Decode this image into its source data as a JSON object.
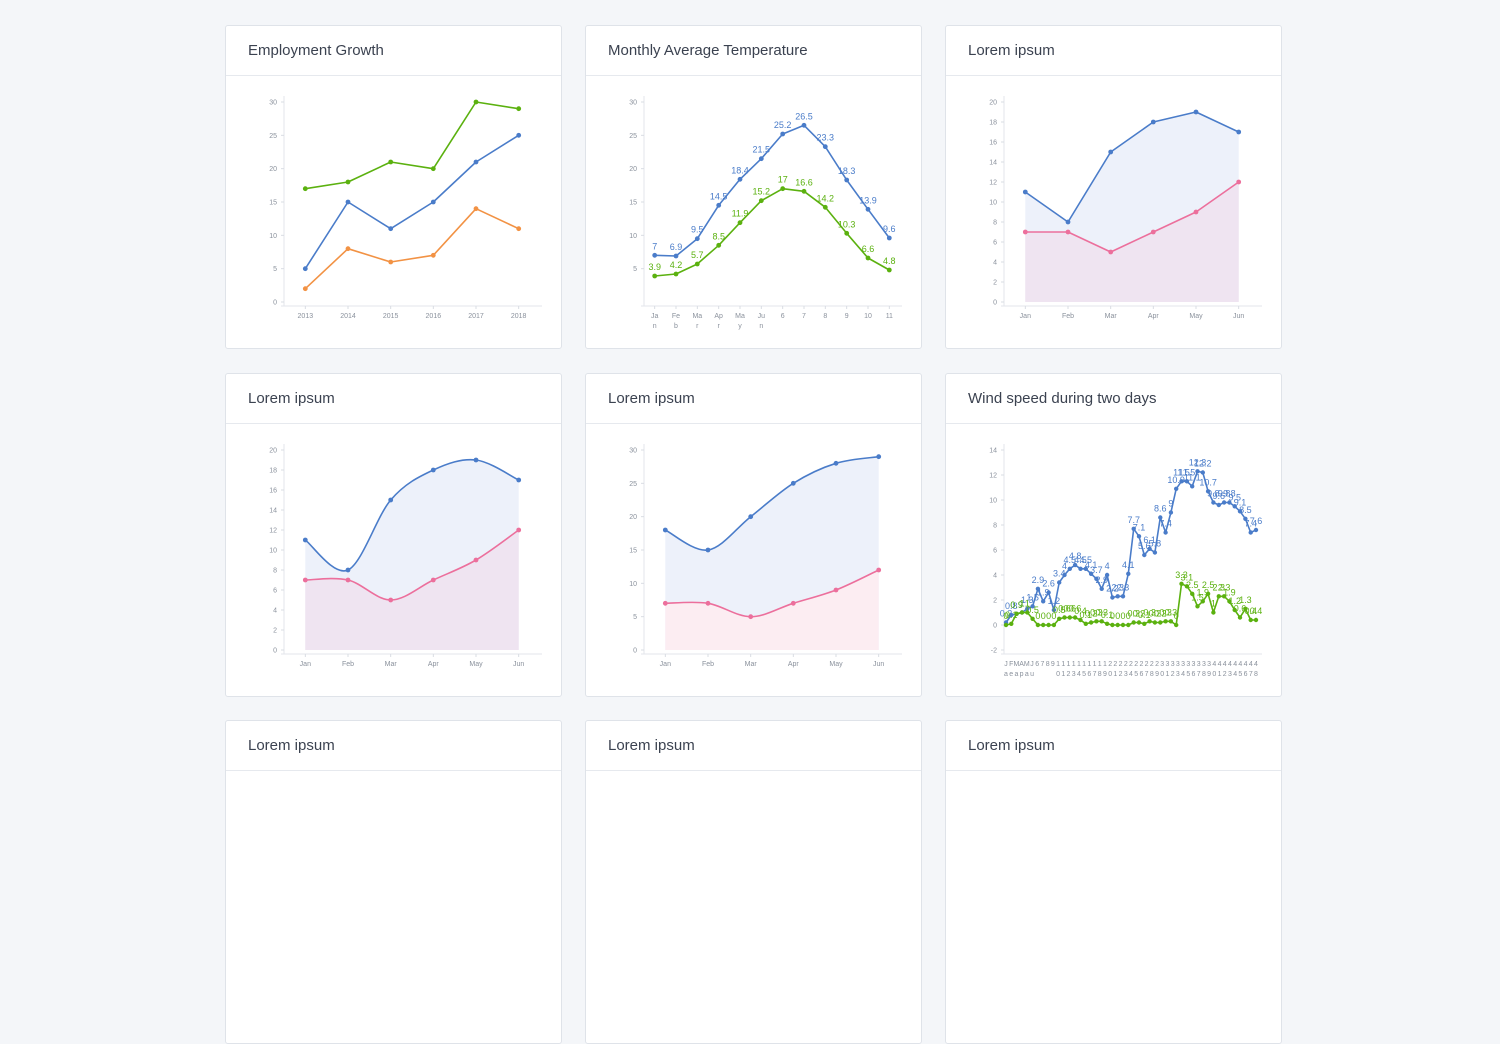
{
  "colors": {
    "blue": "#4a7cc9",
    "green": "#5bb10f",
    "orange": "#f29244",
    "pink": "#ec6f9c"
  },
  "cards": [
    {
      "title": "Employment Growth"
    },
    {
      "title": "Monthly Average Temperature"
    },
    {
      "title": "Lorem ipsum"
    },
    {
      "title": "Lorem ipsum"
    },
    {
      "title": "Lorem ipsum"
    },
    {
      "title": "Wind speed during two days"
    },
    {
      "title": "Lorem ipsum"
    },
    {
      "title": "Lorem ipsum"
    },
    {
      "title": "Lorem ipsum"
    }
  ],
  "chart_data": [
    {
      "type": "line",
      "title": "Employment Growth",
      "categories": [
        "2013",
        "2014",
        "2015",
        "2016",
        "2017",
        "2018"
      ],
      "ylim": [
        0,
        30
      ],
      "yticks": [
        0,
        5,
        10,
        15,
        20,
        25,
        30
      ],
      "series": [
        {
          "color": "#5bb10f",
          "values": [
            17,
            18,
            21,
            20,
            30,
            29
          ]
        },
        {
          "color": "#4a7cc9",
          "values": [
            5,
            15,
            11,
            15,
            21,
            25
          ]
        },
        {
          "color": "#f29244",
          "values": [
            2,
            8,
            6,
            7,
            14,
            11
          ]
        }
      ]
    },
    {
      "type": "line",
      "title": "Monthly Average Temperature",
      "categories": [
        "Ja\nn",
        "Fe\nb",
        "Ma\nr",
        "Ap\nr",
        "Ma\ny",
        "Ju\nn",
        "6",
        "7",
        "8",
        "9",
        "10",
        "11"
      ],
      "ylim": [
        0,
        30
      ],
      "yticks": [
        5,
        10,
        15,
        20,
        25,
        30
      ],
      "data_labels": true,
      "series": [
        {
          "color": "#4a7cc9",
          "values": [
            7,
            6.9,
            9.5,
            14.5,
            18.4,
            21.5,
            25.2,
            26.5,
            23.3,
            18.3,
            13.9,
            9.6
          ]
        },
        {
          "color": "#5bb10f",
          "values": [
            3.9,
            4.2,
            5.7,
            8.5,
            11.9,
            15.2,
            17,
            16.6,
            14.2,
            10.3,
            6.6,
            4.8
          ]
        }
      ]
    },
    {
      "type": "area",
      "categories": [
        "Jan",
        "Feb",
        "Mar",
        "Apr",
        "May",
        "Jun"
      ],
      "ylim": [
        0,
        20
      ],
      "yticks": [
        0,
        2,
        4,
        6,
        8,
        10,
        12,
        14,
        16,
        18,
        20
      ],
      "series": [
        {
          "color": "#4a7cc9",
          "fill": "#edf1fa",
          "values": [
            11,
            8,
            15,
            18,
            19,
            17
          ]
        },
        {
          "color": "#ec6f9c",
          "fill": "#efe4f1",
          "values": [
            7,
            7,
            5,
            7,
            9,
            12
          ]
        }
      ]
    },
    {
      "type": "area",
      "smooth": true,
      "categories": [
        "Jan",
        "Feb",
        "Mar",
        "Apr",
        "May",
        "Jun"
      ],
      "ylim": [
        0,
        20
      ],
      "yticks": [
        0,
        2,
        4,
        6,
        8,
        10,
        12,
        14,
        16,
        18,
        20
      ],
      "series": [
        {
          "color": "#4a7cc9",
          "fill": "#edf1fa",
          "values": [
            11,
            8,
            15,
            18,
            19,
            17
          ]
        },
        {
          "color": "#ec6f9c",
          "fill": "#efe4f1",
          "values": [
            7,
            7,
            5,
            7,
            9,
            12
          ]
        }
      ]
    },
    {
      "type": "area",
      "smooth": true,
      "categories": [
        "Jan",
        "Feb",
        "Mar",
        "Apr",
        "May",
        "Jun"
      ],
      "ylim": [
        0,
        30
      ],
      "yticks": [
        0,
        5,
        10,
        15,
        20,
        25,
        30
      ],
      "series": [
        {
          "color": "#4a7cc9",
          "fill": "#edf1fa",
          "values": [
            18,
            15,
            20,
            25,
            28,
            29
          ]
        },
        {
          "color": "#ec6f9c",
          "fill": "#fcedf2",
          "values": [
            7,
            7,
            5,
            7,
            9,
            12
          ]
        }
      ]
    },
    {
      "type": "line",
      "title": "Wind speed during two days",
      "ylim": [
        -2,
        14
      ],
      "yticks": [
        -2,
        0,
        2,
        4,
        6,
        8,
        10,
        12,
        14
      ],
      "tick_labels_row1": [
        "J",
        "F",
        "M",
        "A",
        "M",
        "J",
        "6",
        "7",
        "8",
        "9",
        "1",
        "1",
        "1",
        "1",
        "1",
        "1",
        "1",
        "1",
        "1",
        "1",
        "2",
        "2",
        "2",
        "2",
        "2",
        "2",
        "2",
        "2",
        "2",
        "2",
        "3",
        "3",
        "3",
        "3",
        "3",
        "3",
        "3",
        "3",
        "3",
        "3",
        "4",
        "4",
        "4",
        "4",
        "4",
        "4",
        "4",
        "4",
        "4"
      ],
      "tick_labels_row2": [
        "a",
        "e",
        "a",
        "p",
        "a",
        "u",
        "",
        "",
        "",
        "",
        "0",
        "1",
        "2",
        "3",
        "4",
        "5",
        "6",
        "7",
        "8",
        "9",
        "0",
        "1",
        "2",
        "3",
        "4",
        "5",
        "6",
        "7",
        "8",
        "9",
        "0",
        "1",
        "2",
        "3",
        "4",
        "5",
        "6",
        "7",
        "8",
        "9",
        "0",
        "1",
        "2",
        "3",
        "4",
        "5",
        "6",
        "7",
        "8"
      ],
      "data_labels": true,
      "series": [
        {
          "color": "#4a7cc9",
          "values": [
            0.2,
            0.8,
            0.9,
            1,
            1.3,
            1.5,
            2.9,
            1.9,
            2.6,
            1.2,
            3.4,
            4,
            4.5,
            4.8,
            4.5,
            4.5,
            4.1,
            3.7,
            2.9,
            4,
            2.2,
            2.3,
            2.3,
            4.1,
            7.7,
            7.1,
            5.6,
            6.1,
            5.8,
            8.6,
            7.4,
            9,
            10.9,
            11.5,
            11.5,
            11.1,
            12.3,
            12.2,
            10.7,
            9.8,
            9.6,
            9.8,
            9.8,
            9.5,
            9.1,
            8.5,
            7.4,
            7.6
          ]
        },
        {
          "color": "#5bb10f",
          "values": [
            0,
            0.1,
            0.9,
            1,
            1,
            0.5,
            0,
            0,
            0,
            0,
            0.5,
            0.6,
            0.6,
            0.6,
            0.4,
            0.1,
            0.2,
            0.3,
            0.3,
            0.1,
            0,
            0,
            0,
            0,
            0.2,
            0.2,
            0.1,
            0.3,
            0.2,
            0.2,
            0.3,
            0.3,
            0,
            3.3,
            3.1,
            2.5,
            1.5,
            1.9,
            2.5,
            1,
            2.3,
            2.3,
            1.9,
            1.2,
            0.6,
            1.3,
            0.4,
            0.4
          ]
        }
      ]
    }
  ]
}
